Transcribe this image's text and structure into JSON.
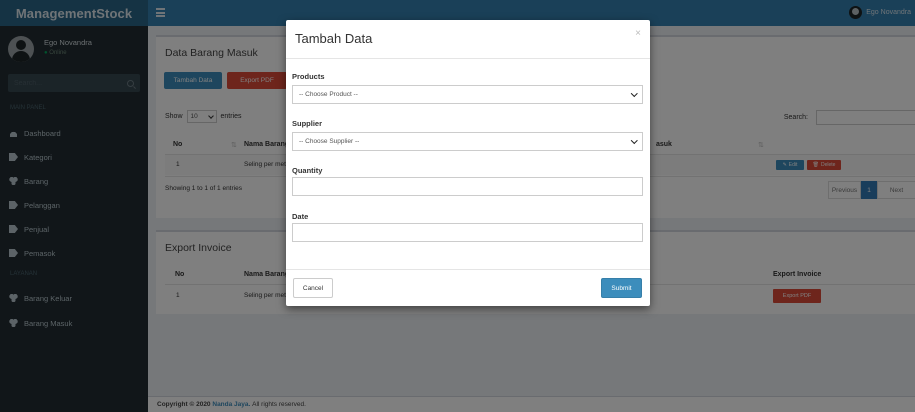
{
  "brand": {
    "logo_text": "ManagementStock"
  },
  "header": {
    "user_name": "Ego Novandra"
  },
  "sidebar": {
    "user_name": "Ego Novandra",
    "user_status": "Online",
    "search_placeholder": "Search...",
    "section_main": "MAIN PANEL",
    "section_second": "LAYANAN",
    "items": [
      {
        "label": "Dashboard",
        "icon": "dashboard-icon"
      },
      {
        "label": "Kategori",
        "icon": "tag-icon"
      },
      {
        "label": "Barang",
        "icon": "cubes-icon"
      },
      {
        "label": "Pelanggan",
        "icon": "tag-icon"
      },
      {
        "label": "Penjual",
        "icon": "tag-icon"
      },
      {
        "label": "Pemasok",
        "icon": "tag-icon"
      },
      {
        "label": "Barang Keluar",
        "icon": "cubes-icon"
      },
      {
        "label": "Barang Masuk",
        "icon": "cubes-icon"
      }
    ]
  },
  "main": {
    "box1_title": "Data Barang Masuk",
    "btn_tambah": "Tambah Data",
    "btn_export_pdf": "Export PDF",
    "show_label": "Show",
    "show_value": "10",
    "entries_label": "entries",
    "search_label": "Search:",
    "table1_headers": [
      "No",
      "Nama Barang",
      "Tanggal Masuk"
    ],
    "table1_header_tail": "asuk",
    "table1_rows": [
      {
        "no": "1",
        "nama": "Seling per meter"
      }
    ],
    "table1_name_visible": "Seling per mete",
    "btn_edit": "Edit",
    "btn_delete": "Delete",
    "showing_text": "Showing 1 to 1 of 1 entries",
    "pager_prev": "Previous",
    "pager_page": "1",
    "pager_next": "Next",
    "box2_title": "Export Invoice",
    "table2_headers": [
      "No",
      "Nama Barang",
      "Export Invoice"
    ],
    "table2_rows": [
      {
        "no": "1",
        "nama": "Seling per meter",
        "action": "Export PDF"
      }
    ],
    "table2_tail_letter": "n"
  },
  "footer": {
    "copyright_prefix": "Copyright © 2020",
    "brand": "Nanda Jaya.",
    "suffix": "All rights reserved."
  },
  "modal": {
    "title": "Tambah Data",
    "close_symbol": "×",
    "products_label": "Products",
    "products_selected": "-- Choose Product --",
    "supplier_label": "Supplier",
    "supplier_selected": "-- Choose Supplier --",
    "quantity_label": "Quantity",
    "quantity_value": "",
    "date_label": "Date",
    "date_value": "",
    "cancel_label": "Cancel",
    "submit_label": "Submit"
  },
  "colors": {
    "header": "#3580b0",
    "logo_bg": "#2b6789",
    "sidebar": "#222d32",
    "primary": "#3c8dbc",
    "danger": "#dd4b39",
    "success": "#00a65a"
  }
}
